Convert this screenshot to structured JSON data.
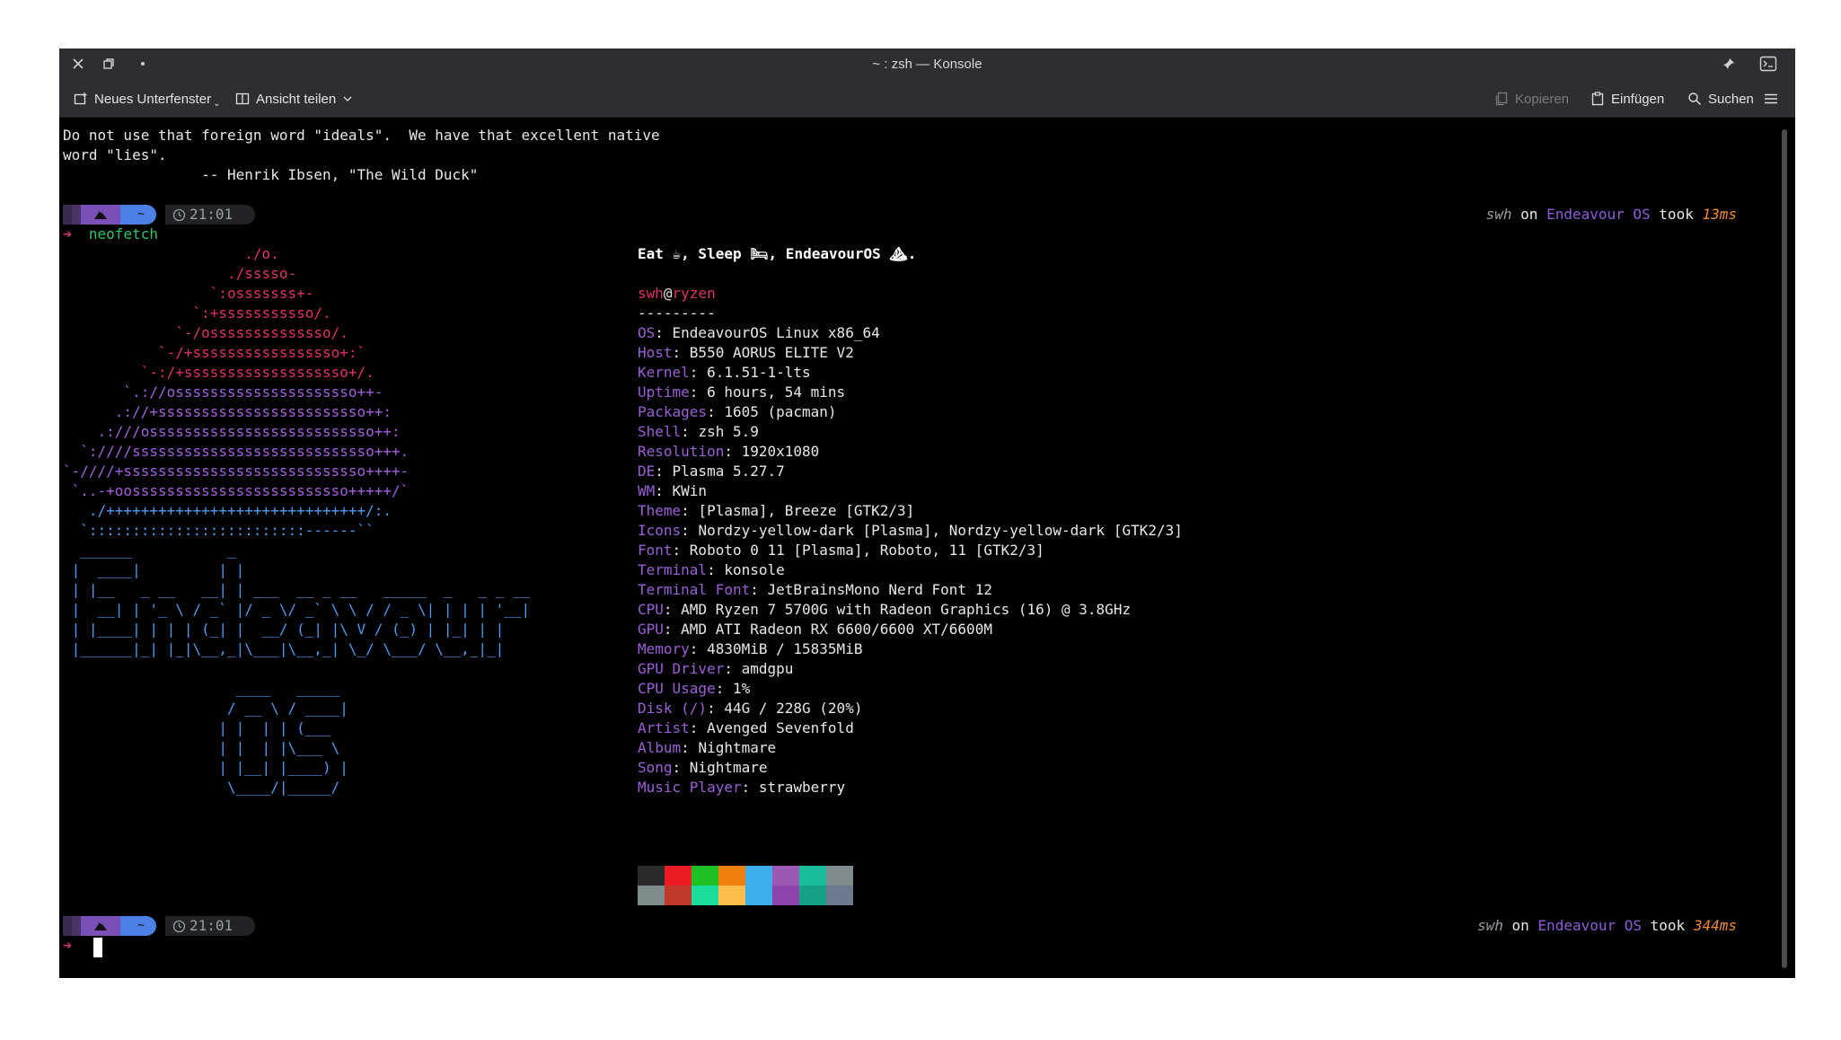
{
  "window": {
    "title": "~ : zsh — Konsole"
  },
  "toolbar": {
    "new_tab": "Neues Unterfenster",
    "split_view": "Ansicht teilen",
    "copy": "Kopieren",
    "paste": "Einfügen",
    "search": "Suchen"
  },
  "terminal": {
    "fortune": [
      "Do not use that foreign word \"ideals\".  We have that excellent native",
      "word \"lies\".",
      "                -- Henrik Ibsen, \"The Wild Duck\""
    ],
    "prompt1": {
      "dir": "~",
      "time": "21:01",
      "user": "swh",
      "on": "on",
      "os": "Endeavour OS",
      "took": "took",
      "duration": "13ms"
    },
    "command": "neofetch",
    "prompt2": {
      "dir": "~",
      "time": "21:01",
      "user": "swh",
      "on": "on",
      "os": "Endeavour OS",
      "took": "took",
      "duration": "344ms"
    },
    "arrow": "➜",
    "logo_art": [
      {
        "text": "                     ./o.",
        "tone": "red"
      },
      {
        "text": "                   ./sssso-",
        "tone": "red"
      },
      {
        "text": "                 `:osssssss+-",
        "tone": "red"
      },
      {
        "text": "               `:+sssssssssso/.",
        "tone": "red"
      },
      {
        "text": "             `-/ossssssssssssso/.",
        "tone": "red"
      },
      {
        "text": "           `-/+sssssssssssssssso+:`",
        "tone": "red"
      },
      {
        "text": "         `-:/+sssssssssssssssssso+/.",
        "tone": "red"
      },
      {
        "text": "       `.://osssssssssssssssssssso++-",
        "tone": "purple"
      },
      {
        "text": "      .://+ssssssssssssssssssssssso++:",
        "tone": "purple"
      },
      {
        "text": "    .:///ossssssssssssssssssssssssso++:",
        "tone": "purple"
      },
      {
        "text": "  `:////ssssssssssssssssssssssssssso+++.",
        "tone": "purple"
      },
      {
        "text": "`-////+ssssssssssssssssssssssssssso++++-",
        "tone": "purple"
      },
      {
        "text": " `..-+oosssssssssssssssssssssssso+++++/`",
        "tone": "purple"
      },
      {
        "text": "   ./++++++++++++++++++++++++++++++/:.",
        "tone": "blue"
      },
      {
        "text": "  `:::::::::::::::::::::::::------``",
        "tone": "blue"
      }
    ],
    "text_art": [
      "  ______           _",
      " |  ____|         | |",
      " | |__   _ __   __| | ___  __ _ __   _____  _   _ _ __",
      " |  __| | '_ \\ / _` |/ _ \\/ _` \\ \\ / / _ \\| | | | '__|",
      " | |____| | | | (_| |  __/ (_| |\\ V / (_) | |_| | |",
      " |______|_| |_|\\__,_|\\___|\\__,_| \\_/ \\___/ \\__,_|_|",
      "",
      "                    ____   _____",
      "                   / __ \\ / ____|",
      "                  | |  | | (___",
      "                  | |  | |\\___ \\",
      "                  | |__| |____) |",
      "                   \\____/|_____/"
    ],
    "header": "Eat ☕, Sleep 🛏, EndeavourOS ⛰.",
    "user": "swh",
    "at": "@",
    "host": "ryzen",
    "separator": "---------",
    "info": [
      {
        "key": "OS",
        "value": "EndeavourOS Linux x86_64"
      },
      {
        "key": "Host",
        "value": "B550 AORUS ELITE V2"
      },
      {
        "key": "Kernel",
        "value": "6.1.51-1-lts"
      },
      {
        "key": "Uptime",
        "value": "6 hours, 54 mins"
      },
      {
        "key": "Packages",
        "value": "1605 (pacman)"
      },
      {
        "key": "Shell",
        "value": "zsh 5.9"
      },
      {
        "key": "Resolution",
        "value": "1920x1080"
      },
      {
        "key": "DE",
        "value": "Plasma 5.27.7"
      },
      {
        "key": "WM",
        "value": "KWin"
      },
      {
        "key": "Theme",
        "value": "[Plasma], Breeze [GTK2/3]"
      },
      {
        "key": "Icons",
        "value": "Nordzy-yellow-dark [Plasma], Nordzy-yellow-dark [GTK2/3]"
      },
      {
        "key": "Font",
        "value": "Roboto 0 11 [Plasma], Roboto, 11 [GTK2/3]"
      },
      {
        "key": "Terminal",
        "value": "konsole"
      },
      {
        "key": "Terminal Font",
        "value": "JetBrainsMono Nerd Font 12"
      },
      {
        "key": "CPU",
        "value": "AMD Ryzen 7 5700G with Radeon Graphics (16) @ 3.8GHz"
      },
      {
        "key": "GPU",
        "value": "AMD ATI Radeon RX 6600/6600 XT/6600M"
      },
      {
        "key": "Memory",
        "value": "4830MiB / 15835MiB"
      },
      {
        "key": "GPU Driver",
        "value": "amdgpu"
      },
      {
        "key": "CPU Usage",
        "value": "1%"
      },
      {
        "key": "Disk (/)",
        "value": "44G / 228G (20%)"
      },
      {
        "key": "Artist",
        "value": "Avenged Sevenfold"
      },
      {
        "key": "Album",
        "value": "Nightmare"
      },
      {
        "key": "Song",
        "value": "Nightmare"
      },
      {
        "key": "Music Player",
        "value": "strawberry"
      }
    ],
    "palette": [
      [
        "#2b2b2b",
        "#ed1b24",
        "#1dc121",
        "#f07f0c",
        "#3daee9",
        "#9b59b6",
        "#1abc9c",
        "#7f8c8d"
      ],
      [
        "#7f8c8d",
        "#c0392b",
        "#1cdc9a",
        "#fdbc4b",
        "#3daee9",
        "#8e44ad",
        "#16a085",
        "#6b7b8d"
      ]
    ]
  },
  "colors": {
    "accent_purple": "#9a5fd6",
    "accent_red": "#e0306c",
    "accent_blue": "#4d9cf0",
    "duration_orange": "#f08a2c",
    "titlebar": "#2d2e32"
  }
}
